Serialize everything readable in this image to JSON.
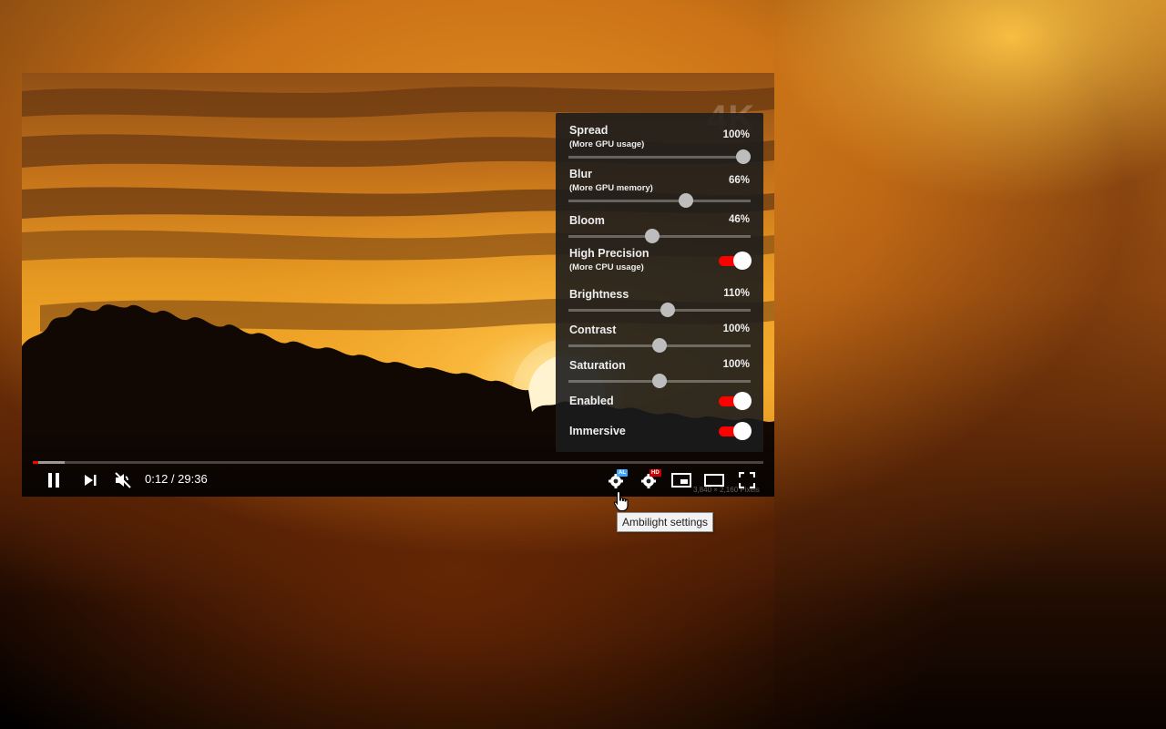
{
  "video": {
    "watermark": "4K",
    "stats_text": "3,840 × 2,160 Pixels",
    "progress_fraction": 0.0068,
    "buffer_fraction": 0.044
  },
  "controls": {
    "play_pause_icon": "pause-icon",
    "next_icon": "skip-next-icon",
    "mute_icon": "volume-muted-icon",
    "time": "0:12 / 29:36",
    "ambilight_icon": "gear-icon",
    "ambilight_badge": "AL",
    "quality_icon": "gear-icon",
    "quality_badge": "HD",
    "miniplayer_icon": "miniplayer-icon",
    "theater_icon": "theater-mode-icon",
    "fullscreen_icon": "fullscreen-icon"
  },
  "settings": {
    "spread": {
      "label": "Spread",
      "sub": "(More GPU usage)",
      "value": "100%",
      "level": 0.96
    },
    "blur": {
      "label": "Blur",
      "sub": "(More GPU memory)",
      "value": "66%",
      "level": 0.645
    },
    "bloom": {
      "label": "Bloom",
      "value": "46%",
      "level": 0.46
    },
    "high_precision": {
      "label": "High Precision",
      "sub": "(More CPU usage)",
      "on": true
    },
    "brightness": {
      "label": "Brightness",
      "value": "110%",
      "level": 0.545
    },
    "contrast": {
      "label": "Contrast",
      "value": "100%",
      "level": 0.5
    },
    "saturation": {
      "label": "Saturation",
      "value": "100%",
      "level": 0.5
    },
    "enabled": {
      "label": "Enabled",
      "on": true
    },
    "immersive": {
      "label": "Immersive",
      "on": true
    }
  },
  "tooltip": {
    "text": "Ambilight settings"
  },
  "colors": {
    "accent": "#ff0000",
    "panel_bg": "#1c1c1c",
    "thumb": "#bdbdbd"
  }
}
